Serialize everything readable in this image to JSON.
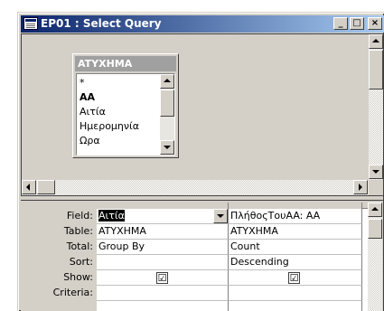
{
  "window": {
    "title": "EP01 : Select Query",
    "minimize_label": "_",
    "restore_label": "□",
    "close_label": "×"
  },
  "table_box": {
    "title": "ATYXHMA",
    "fields": [
      "*",
      "AA",
      "Αιτία",
      "Ημερομηνία",
      "Ωρα"
    ]
  },
  "grid": {
    "row_labels": [
      "Field:",
      "Table:",
      "Total:",
      "Sort:",
      "Show:",
      "Criteria:"
    ],
    "columns": [
      {
        "field": "Αιτία",
        "table": "ATYXHMA",
        "total": "Group By",
        "sort": "",
        "show": "☑",
        "criteria": ""
      },
      {
        "field": "ΠλήθοςΤουAA: AA",
        "table": "ATYXHMA",
        "total": "Count",
        "sort": "Descending",
        "show": "☑",
        "criteria": ""
      }
    ]
  },
  "icons": {
    "title": "query-window-icon",
    "checkbox_checked": "check-icon"
  },
  "colors": {
    "titlebar_start": "#0a246a",
    "titlebar_end": "#a6caf0",
    "face": "#d4d0c8",
    "upper_pane": "#808080"
  }
}
